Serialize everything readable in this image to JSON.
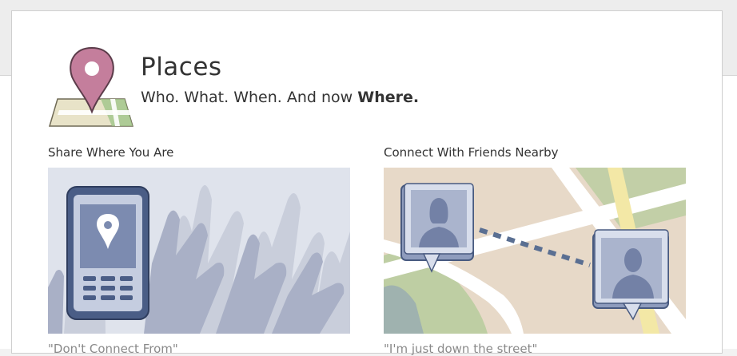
{
  "header": {
    "title": "Places",
    "subtitle_prefix": "Who. What. When. And now ",
    "subtitle_strong": "Where."
  },
  "sections": [
    {
      "heading": "Share Where You Are",
      "caption": "\"Don't Connect From\""
    },
    {
      "heading": "Connect With Friends Nearby",
      "caption": "\"I'm just down the street\""
    }
  ],
  "colors": {
    "pin": "#c47e9c",
    "panel_bg": "#dfe3ec",
    "map_bg": "#e7d9c8"
  }
}
